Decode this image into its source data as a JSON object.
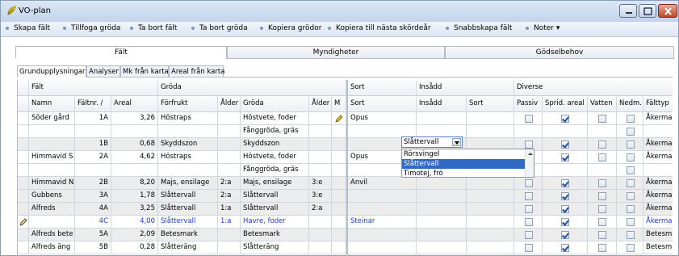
{
  "window": {
    "title": "VO-plan"
  },
  "toolbar": {
    "items": [
      "Skapa fält",
      "Tillfoga gröda",
      "Ta bort fält",
      "Ta bort gröda",
      "Kopiera grödor",
      "Kopiera till nästa skördeår",
      "Snabbskapa fält",
      "Noter ▾"
    ]
  },
  "outer_tabs": [
    "Fält",
    "Myndigheter",
    "Gödselbehov"
  ],
  "inner_tabs": [
    "Grundupplysningar",
    "Analyser",
    "Mk från karta",
    "Areal från karta"
  ],
  "group_headers": {
    "falt": "Fält",
    "groda": "Gröda",
    "sort": "Sort",
    "insadd": "Insådd",
    "diverse": "Diverse"
  },
  "column_headers": {
    "namn": "Namn",
    "faltnr": "Fältnr. /",
    "areal": "Areal",
    "forfrukt": "Förfrukt",
    "alder1": "Ålder",
    "groda": "Gröda",
    "alder2": "Ålder",
    "m": "M",
    "sort": "Sort",
    "insadd": "Insådd",
    "sort2": "Sort",
    "passiv": "Passiv",
    "sprid": "Sprid. areal",
    "vatten": "Vatten",
    "nedm": "Nedm.",
    "falttyp": "Fälttyp"
  },
  "rows": [
    {
      "namn": "Söder gård",
      "faltnr": "1A",
      "areal": "3,26",
      "forfrukt": "Höstraps",
      "alder1": "",
      "groda": "Höstvete, foder",
      "alder2": "",
      "sort": "Opus",
      "insadd": "",
      "falttyp": "Åkermark"
    },
    {
      "namn": "",
      "faltnr": "",
      "areal": "",
      "forfrukt": "",
      "alder1": "",
      "groda": "Fånggröda, gräs",
      "alder2": "",
      "sort": "",
      "insadd": "",
      "falttyp": ""
    },
    {
      "namn": "",
      "faltnr": "1B",
      "areal": "0,68",
      "forfrukt": "Skyddszon",
      "alder1": "",
      "groda": "Skyddszon",
      "alder2": "",
      "sort": "",
      "insadd": "",
      "falttyp": "Åkermark"
    },
    {
      "namn": "Himmavid S",
      "faltnr": "2A",
      "areal": "4,62",
      "forfrukt": "Höstraps",
      "alder1": "",
      "groda": "Höstvete, foder",
      "alder2": "",
      "sort": "Opus",
      "insadd": "",
      "falttyp": "Åkermark"
    },
    {
      "namn": "",
      "faltnr": "",
      "areal": "",
      "forfrukt": "",
      "alder1": "",
      "groda": "Fånggröda, gräs",
      "alder2": "",
      "sort": "",
      "insadd": "",
      "falttyp": ""
    },
    {
      "namn": "Himmavid N",
      "faltnr": "2B",
      "areal": "8,20",
      "forfrukt": "Majs, ensilage",
      "alder1": "2:a",
      "groda": "Majs, ensilage",
      "alder2": "3:e",
      "sort": "Anvil",
      "insadd": "",
      "falttyp": "Åkermark"
    },
    {
      "namn": "Gubbens",
      "faltnr": "3A",
      "areal": "1,78",
      "forfrukt": "Slåttervall",
      "alder1": "2:a",
      "groda": "Slåttervall",
      "alder2": "3:e",
      "sort": "",
      "insadd": "",
      "falttyp": "Åkermark"
    },
    {
      "namn": "Alfreds",
      "faltnr": "4A",
      "areal": "3,25",
      "forfrukt": "Slåttervall",
      "alder1": "1:a",
      "groda": "Slåttervall",
      "alder2": "2:a",
      "sort": "",
      "insadd": "",
      "falttyp": "Åkermark"
    },
    {
      "namn": "",
      "faltnr": "4C",
      "areal": "4,00",
      "forfrukt": "Slåttervall",
      "alder1": "1:a",
      "groda": "Havre, foder",
      "alder2": "",
      "sort": "Steinar",
      "insadd": "",
      "falttyp": "Åkermark"
    },
    {
      "namn": "Alfreds bete",
      "faltnr": "5A",
      "areal": "2,09",
      "forfrukt": "Betesmark",
      "alder1": "",
      "groda": "Betesmark",
      "alder2": "",
      "sort": "",
      "insadd": "",
      "falttyp": "Betesmark"
    },
    {
      "namn": "Alfreds äng",
      "faltnr": "5B",
      "areal": "0,28",
      "forfrukt": "Slåtteräng",
      "alder1": "",
      "groda": "Slåtteräng",
      "alder2": "",
      "sort": "",
      "insadd": "",
      "falttyp": "Betesmark"
    }
  ],
  "checkbox_state": [
    [
      false,
      true,
      false,
      false
    ],
    [
      null,
      null,
      null,
      false
    ],
    [
      false,
      true,
      false,
      false
    ],
    [
      false,
      true,
      false,
      false
    ],
    [
      null,
      null,
      null,
      false
    ],
    [
      false,
      true,
      false,
      false
    ],
    [
      false,
      true,
      false,
      false
    ],
    [
      false,
      true,
      false,
      false
    ],
    [
      false,
      true,
      false,
      false
    ],
    [
      false,
      true,
      false,
      false
    ],
    [
      false,
      true,
      false,
      false
    ]
  ],
  "combo": {
    "value": "Slåttervall"
  },
  "dropdown_options": [
    "Rörsvingel",
    "Slåttervall",
    "Timotej, frö"
  ],
  "dropdown_selected": "Slåttervall",
  "colors": {
    "title_bar": "#c9d8ec",
    "gray_row": "#ececec",
    "edit_text": "#1d3bd6",
    "selection": "#3169c6"
  }
}
